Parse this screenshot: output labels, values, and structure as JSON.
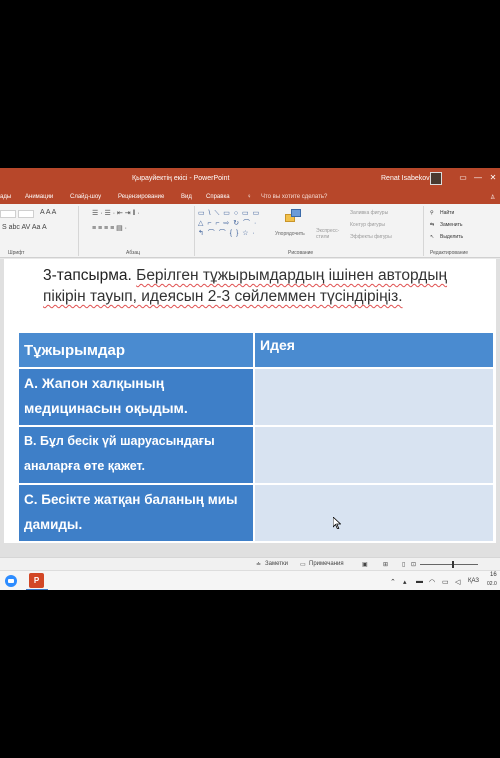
{
  "window": {
    "doc_title": "Қырауйектің екісі  -  PowerPoint",
    "user_name": "Renat Isabekov",
    "win_buttons": [
      "▭",
      "—",
      "✕"
    ]
  },
  "menu": {
    "items": [
      "ады",
      "Анимации",
      "Слайд-шоу",
      "Рецензирование",
      "Вид",
      "Справка"
    ],
    "search_hint": "Что вы хотите сделать?",
    "share_icon": "person-icon"
  },
  "ribbon": {
    "groups": [
      "Шрифт",
      "Абзац",
      "Рисование",
      "Редактирование"
    ],
    "font_size_glyphs": "A A  A",
    "format_glyphs": "S  abc  AV  Aa  A",
    "paragraph_glyphs_1": "☰ · ☰ ·  ⇤ ⇥  ‖ ·",
    "paragraph_glyphs_2": "≡ ≡ ≡ ≡  ▤ ·",
    "shape_rows": [
      "▭ \\ ⟍ ▭ ○ ▭ ▭",
      "△ ⌐ ⌐ ⇨ ↻ ⌒ ·",
      "↰ ⌒ ⌒ { } ☆ ·"
    ],
    "arrange_label": "Упорядочить",
    "quick_styles_label": "Экспресс-стили",
    "shape_fill": "Заливка фигуры",
    "shape_outline": "Контур фигуры",
    "shape_effects": "Эффекты фигуры",
    "find": "Найти",
    "replace": "Заменить",
    "select": "Выделить"
  },
  "slide": {
    "task_label": "3-тапсырма",
    "task_text": "Берілген тұжырымдардың ішінен автордың пікірін тауып, идеясын 2-3 сөйлеммен түсіндіріңіз.",
    "table": {
      "headers": [
        "Тұжырымдар",
        "Идея"
      ],
      "rows": [
        {
          "statement": "A. Жапон халқының медицинасын оқыдым.",
          "idea": ""
        },
        {
          "statement": "B. Бұл бесік үй шаруасындағы аналарға өте қажет.",
          "idea": ""
        },
        {
          "statement": "C. Бесікте жатқан баланың миы дамиды.",
          "idea": ""
        }
      ]
    }
  },
  "statusbar": {
    "notes": "Заметки",
    "comments": "Примечания"
  },
  "taskbar": {
    "lang": "ҚАЗ",
    "time": "16",
    "date": "02.0"
  },
  "colors": {
    "ppt_red": "#b7472a",
    "table_header": "#4a8bd0",
    "table_stmt": "#3e7fc8",
    "table_idea": "#d8e3f1"
  }
}
